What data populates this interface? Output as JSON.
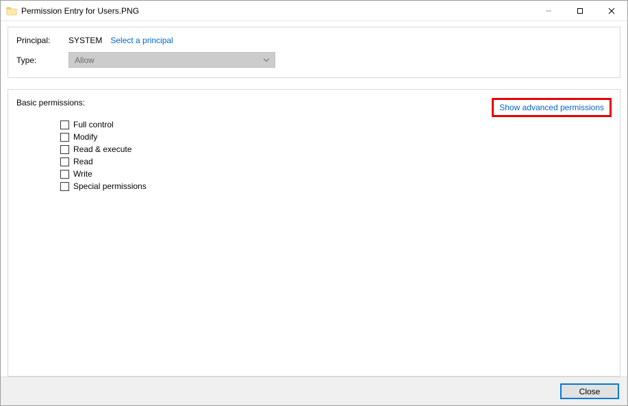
{
  "window": {
    "title": "Permission Entry for Users.PNG"
  },
  "header": {
    "principal_label": "Principal:",
    "principal_value": "SYSTEM",
    "select_principal_link": "Select a principal",
    "type_label": "Type:",
    "type_value": "Allow"
  },
  "permissions": {
    "title": "Basic permissions:",
    "advanced_link": "Show advanced permissions",
    "items": [
      {
        "label": "Full control",
        "checked": false
      },
      {
        "label": "Modify",
        "checked": false
      },
      {
        "label": "Read & execute",
        "checked": false
      },
      {
        "label": "Read",
        "checked": false
      },
      {
        "label": "Write",
        "checked": false
      },
      {
        "label": "Special permissions",
        "checked": false
      }
    ]
  },
  "footer": {
    "close_label": "Close"
  }
}
